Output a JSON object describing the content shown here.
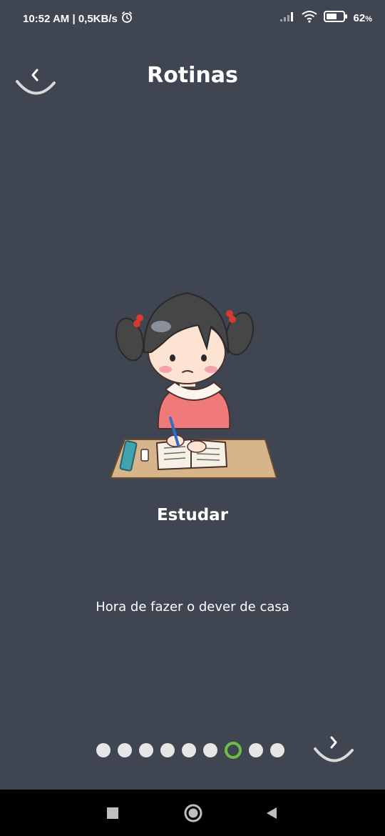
{
  "status_bar": {
    "time_speed": "10:52 AM | 0,5KB/s",
    "battery_percent": "62",
    "battery_unit": "%",
    "battery_level": 0.62,
    "icons": [
      "alarm-icon",
      "signal-icon",
      "wifi-icon",
      "battery-icon"
    ]
  },
  "header": {
    "title": "Rotinas",
    "back_icon": "chevron-left-icon"
  },
  "card": {
    "illustration": "girl-studying-illustration",
    "title": "Estudar",
    "description": "Hora de fazer o dever de casa"
  },
  "pager": {
    "total": 9,
    "current_index": 6,
    "next_icon": "chevron-right-icon",
    "active_color": "#6cbe45",
    "inactive_color": "#e6e6e6"
  },
  "nav_bar": {
    "buttons": [
      "recents-button",
      "home-button",
      "back-button"
    ]
  },
  "colors": {
    "background": "#3f4551",
    "text": "#ffffff"
  }
}
